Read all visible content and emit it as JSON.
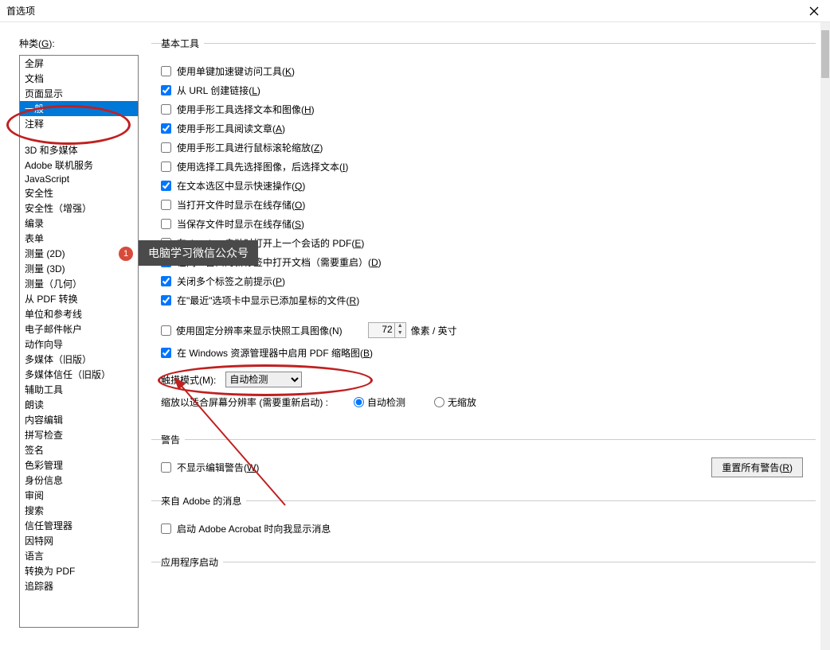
{
  "title": "首选项",
  "categories_label": "种类(",
  "categories_hotkey": "G",
  "categories_suffix": "):",
  "categories_group1": [
    "全屏",
    "文档",
    "页面显示",
    "一般",
    "注释"
  ],
  "categories_group2": [
    "3D 和多媒体",
    "Adobe 联机服务",
    "JavaScript",
    "安全性",
    "安全性（增强）",
    "编录",
    "表单",
    "测量 (2D)",
    "测量 (3D)",
    "测量（几何）",
    "从 PDF 转换",
    "单位和参考线",
    "电子邮件帐户",
    "动作向导",
    "多媒体（旧版）",
    "多媒体信任（旧版）",
    "辅助工具",
    "朗读",
    "内容编辑",
    "拼写检查",
    "签名",
    "色彩管理",
    "身份信息",
    "审阅",
    "搜索",
    "信任管理器",
    "因特网",
    "语言",
    "转换为 PDF",
    "追踪器"
  ],
  "selected_category": "一般",
  "sections": {
    "basic_tools": {
      "legend": "基本工具",
      "items": [
        {
          "checked": false,
          "label": "使用单键加速键访问工具(",
          "k": "K",
          "after": ")"
        },
        {
          "checked": true,
          "label": "从 URL 创建链接(",
          "k": "L",
          "after": ")"
        },
        {
          "checked": false,
          "label": "使用手形工具选择文本和图像(",
          "k": "H",
          "after": ")"
        },
        {
          "checked": true,
          "label": "使用手形工具阅读文章(",
          "k": "A",
          "after": ")"
        },
        {
          "checked": false,
          "label": "使用手形工具进行鼠标滚轮缩放(",
          "k": "Z",
          "after": ")"
        },
        {
          "checked": false,
          "label": "使用选择工具先选择图像，后选择文本(",
          "k": "I",
          "after": ")"
        },
        {
          "checked": true,
          "label": "在文本选区中显示快速操作(",
          "k": "Q",
          "after": ")"
        },
        {
          "checked": false,
          "label": "当打开文件时显示在线存储(",
          "k": "O",
          "after": ")"
        },
        {
          "checked": false,
          "label": "当保存文件时显示在线存储(",
          "k": "S",
          "after": ")"
        },
        {
          "checked": false,
          "label": "在 Acrobat 启动时打开上一个会话的 PDF(",
          "k": "E",
          "after": ")"
        },
        {
          "checked": true,
          "label": "在同一窗口的新标签中打开文档（需要重启）(",
          "k": "D",
          "after": ")"
        },
        {
          "checked": true,
          "label": "关闭多个标签之前提示(",
          "k": "P",
          "after": ")"
        },
        {
          "checked": true,
          "label": "在\"最近\"选项卡中显示已添加星标的文件(",
          "k": "R",
          "after": ")"
        }
      ],
      "fixed_res_row": {
        "checked": false,
        "label": "使用固定分辨率来显示快照工具图像(",
        "k": "N",
        "after": ")",
        "value": "72",
        "unit": "像素 / 英寸"
      },
      "thumb_row": {
        "checked": true,
        "label": "在 Windows 资源管理器中启用 PDF 缩略图(",
        "k": "B",
        "after": ")"
      },
      "touch_mode": {
        "label": "触摸模式(",
        "k": "M",
        "after": "):",
        "value": "自动检测"
      },
      "scale_row": {
        "label": "缩放以适合屏幕分辨率 (需要重新启动) :",
        "opt1": "自动检测",
        "opt2": "无缩放"
      }
    },
    "warning": {
      "legend": "警告",
      "item": {
        "checked": false,
        "label": "不显示编辑警告(",
        "k": "W",
        "after": ")"
      },
      "reset_btn": {
        "label": "重置所有警告(",
        "k": "R",
        "after": ")"
      }
    },
    "adobe_msg": {
      "legend": "来自 Adobe 的消息",
      "item": {
        "checked": false,
        "label": "启动 Adobe Acrobat 时向我显示消息"
      }
    },
    "app_startup": {
      "legend": "应用程序启动"
    }
  },
  "annotations": {
    "badge": "1",
    "tooltip": "电脑学习微信公众号"
  }
}
